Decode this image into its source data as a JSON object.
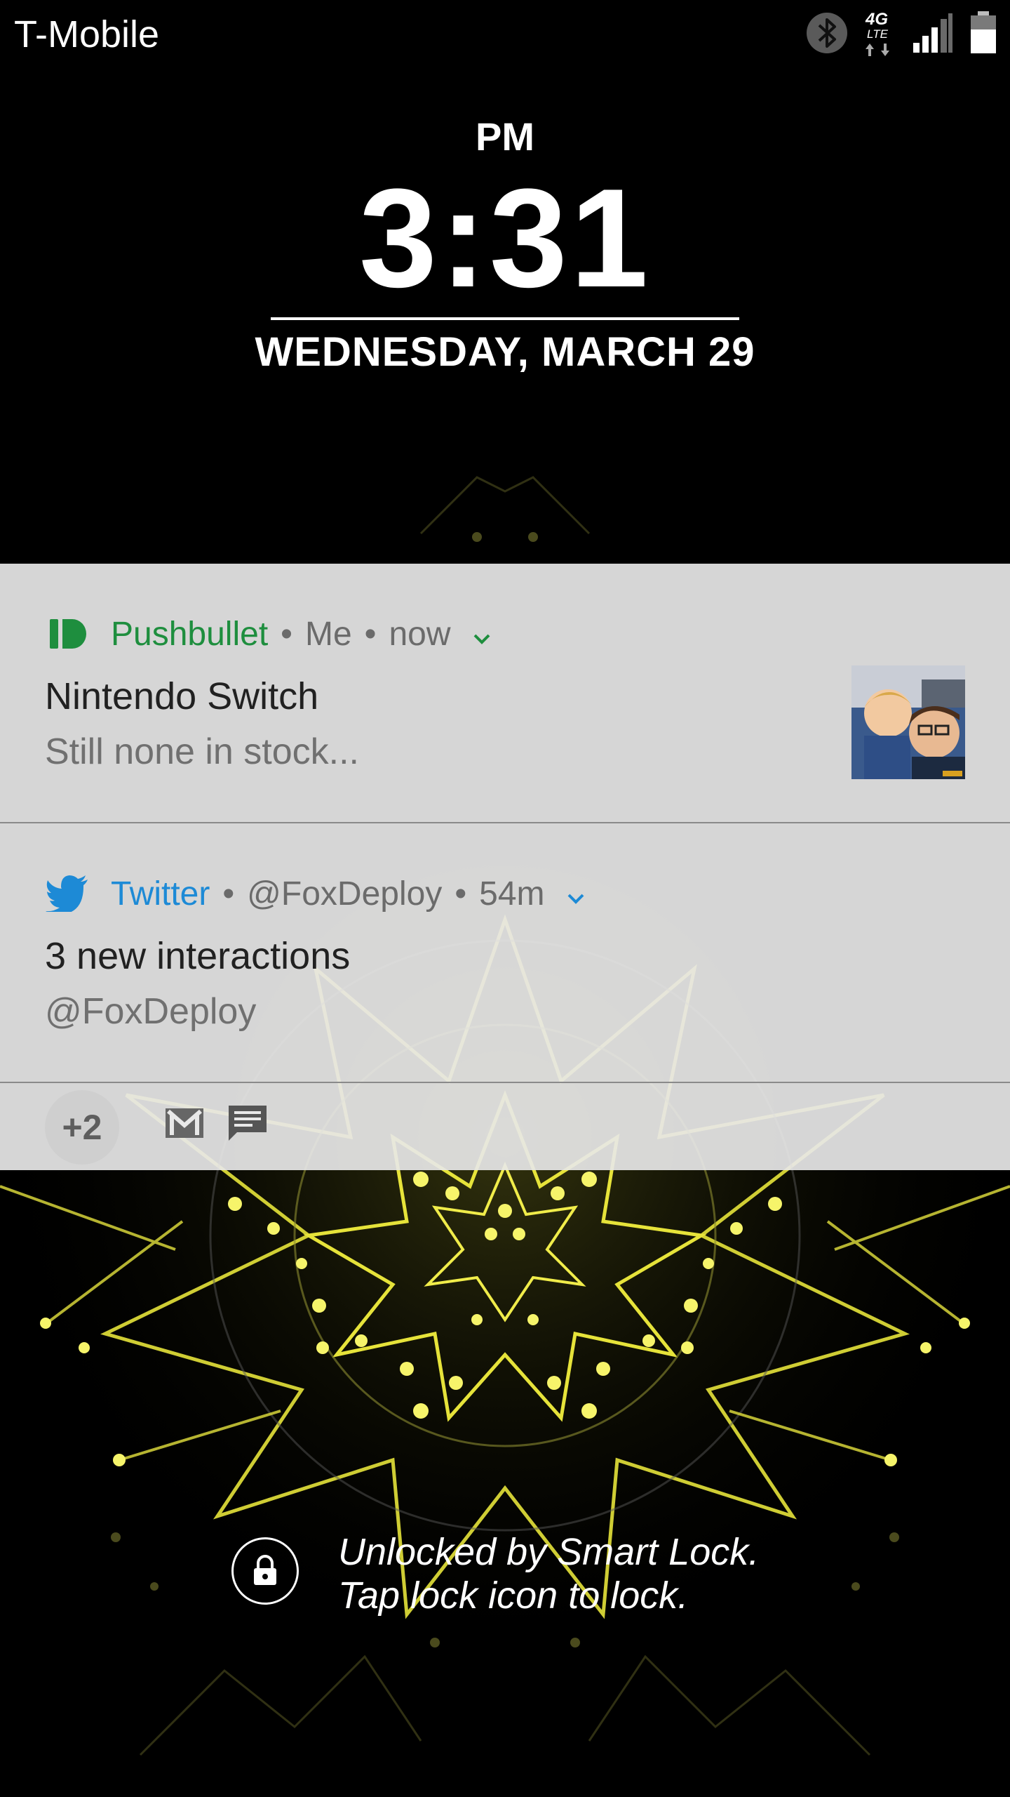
{
  "status_bar": {
    "carrier": "T-Mobile",
    "network_badge_top": "4G",
    "network_badge_bottom": "LTE",
    "icons": [
      "bluetooth-icon",
      "lte-data-icon",
      "cell-signal-icon",
      "battery-icon"
    ]
  },
  "clock": {
    "ampm": "PM",
    "time": "3:31",
    "date": "WEDNESDAY, MARCH 29"
  },
  "colors": {
    "pushbullet_green": "#1e8e3e",
    "twitter_blue": "#1d8ad6",
    "shade_bg": "#e8e8e8",
    "wallpaper_glow": "#e8e83a"
  },
  "notifications": [
    {
      "app": "Pushbullet",
      "app_icon": "pushbullet-icon",
      "sep1": "•",
      "sender": "Me",
      "sep2": "•",
      "time": "now",
      "title": "Nintendo Switch",
      "body": "Still none in stock...",
      "has_thumbnail": true
    },
    {
      "app": "Twitter",
      "app_icon": "twitter-bird-icon",
      "sep1": "•",
      "sender": "@FoxDeploy",
      "sep2": "•",
      "time": "54m",
      "title": "3 new interactions",
      "body": "@FoxDeploy"
    }
  ],
  "overflow": {
    "count_label": "+2",
    "icons": [
      "gmail-icon",
      "messages-icon"
    ]
  },
  "smart_lock": {
    "line1": "Unlocked by Smart Lock.",
    "line2": "Tap lock icon to lock."
  }
}
